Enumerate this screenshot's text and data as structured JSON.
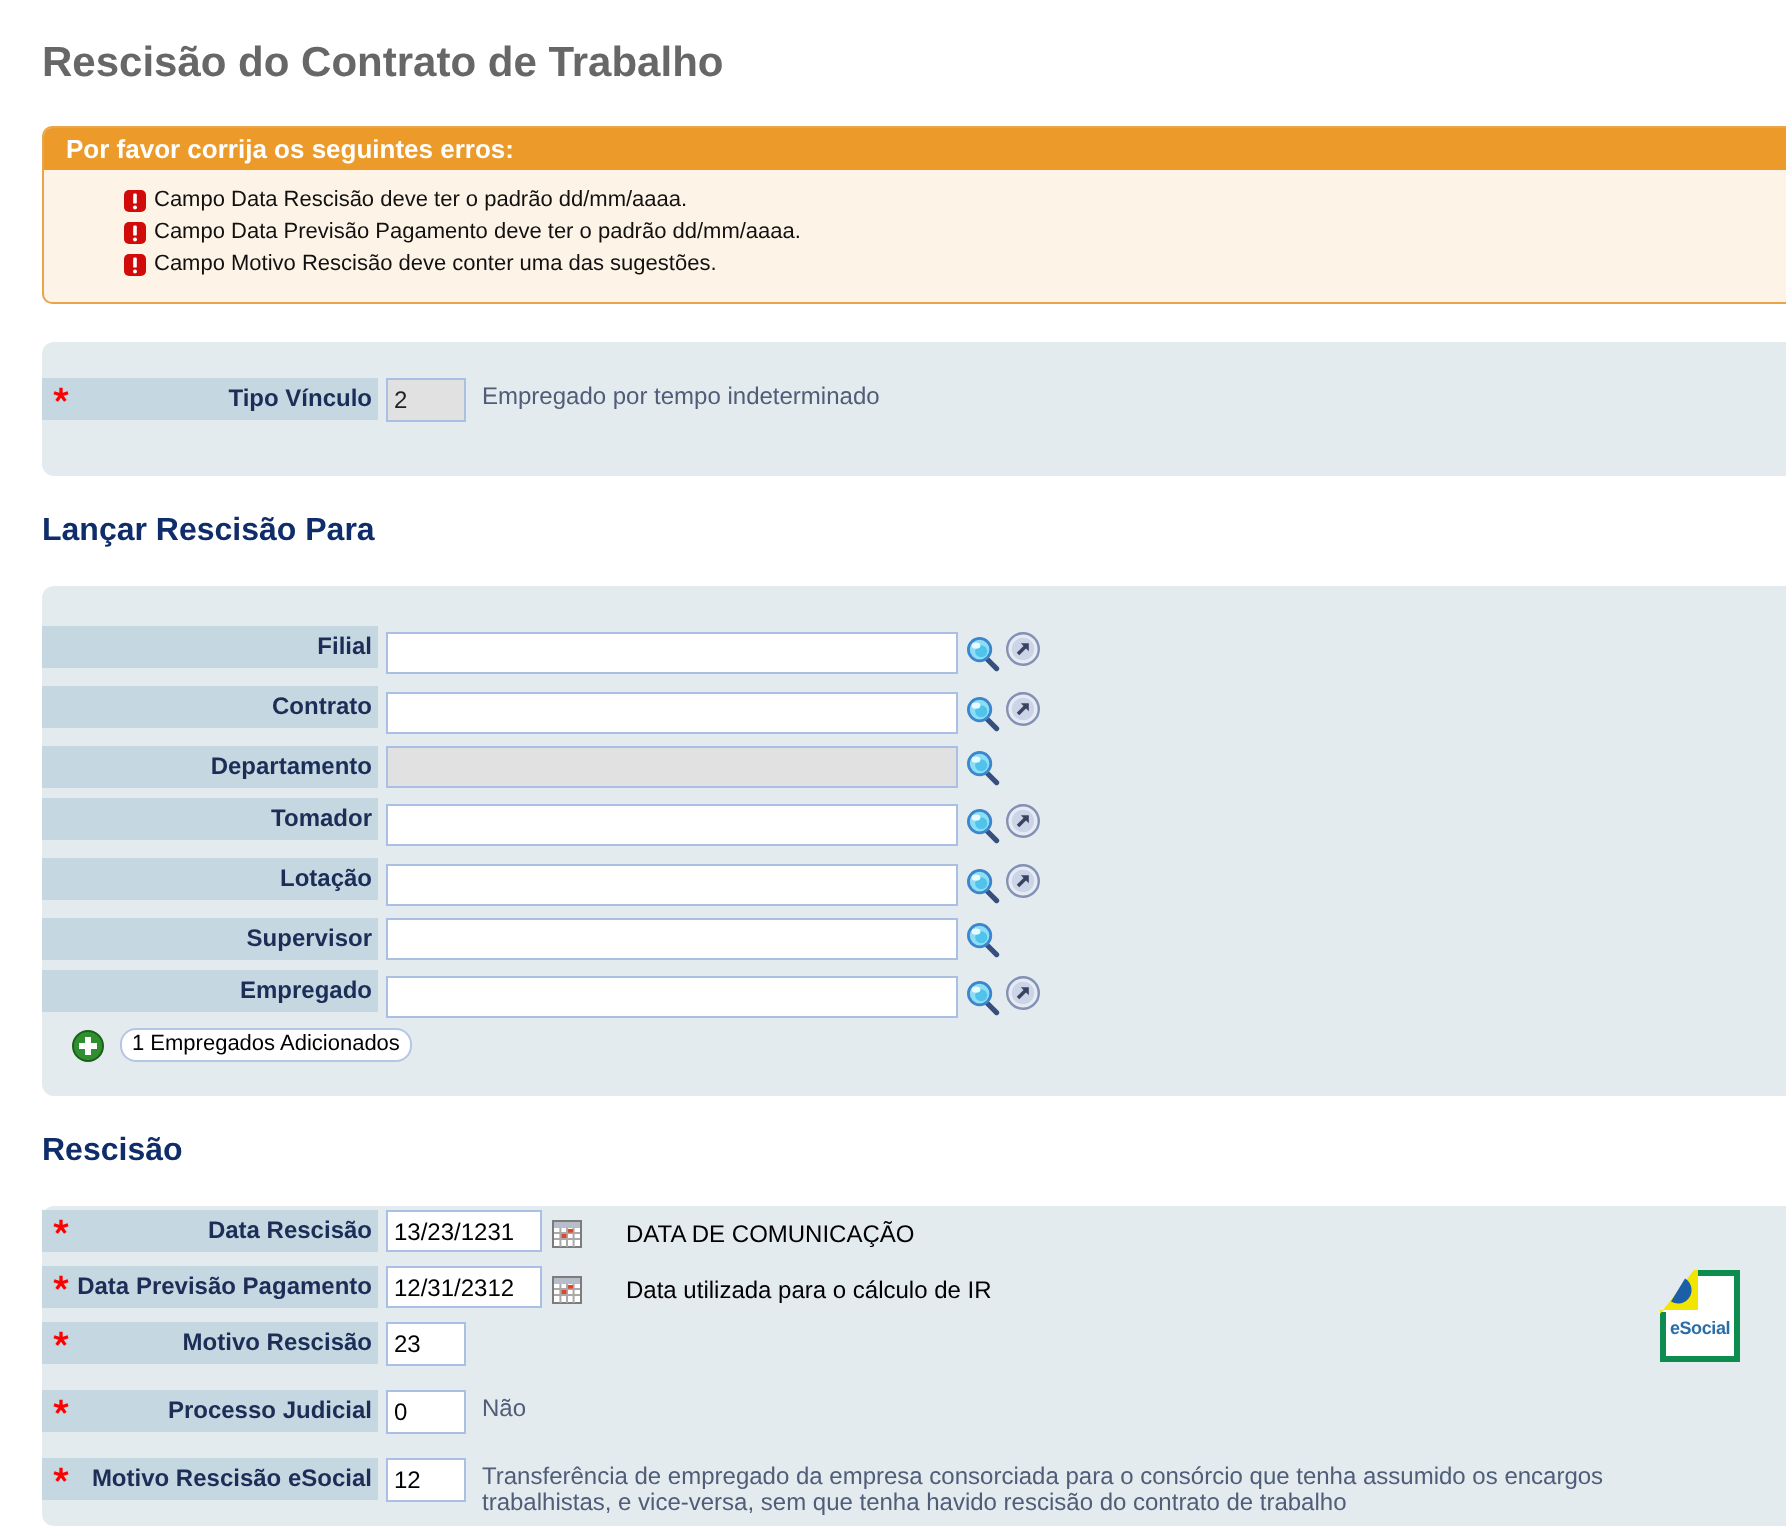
{
  "page": {
    "title": "Rescisão do Contrato de Trabalho"
  },
  "errors": {
    "title": "Por favor corrija os seguintes erros:",
    "items": [
      "Campo Data Rescisão deve ter o padrão dd/mm/aaaa.",
      "Campo Data Previsão Pagamento deve ter o padrão dd/mm/aaaa.",
      "Campo Motivo Rescisão deve conter uma das sugestões."
    ]
  },
  "vinculo": {
    "fields": [
      {
        "label": "Tipo Vínculo",
        "kind": "code",
        "required": true,
        "disabled": true,
        "value": "2",
        "description": "Empregado por tempo indeterminado"
      }
    ]
  },
  "lancar": {
    "title": "Lançar Rescisão Para",
    "fields": [
      {
        "label": "Filial",
        "disabled": false,
        "lookup": true,
        "shortcut": true
      },
      {
        "label": "Contrato",
        "disabled": false,
        "lookup": true,
        "shortcut": true
      },
      {
        "label": "Departamento",
        "disabled": true,
        "lookup": true,
        "shortcut": false
      },
      {
        "label": "Tomador",
        "disabled": false,
        "lookup": true,
        "shortcut": true
      },
      {
        "label": "Lotação",
        "disabled": false,
        "lookup": true,
        "shortcut": true
      },
      {
        "label": "Supervisor",
        "disabled": false,
        "lookup": true,
        "shortcut": false
      },
      {
        "label": "Empregado",
        "disabled": false,
        "lookup": true,
        "shortcut": true
      }
    ],
    "added_button": "1 Empregados Adicionados"
  },
  "rescisao": {
    "title": "Rescisão",
    "fields": [
      {
        "label": "Data Rescisão",
        "kind": "date",
        "required": true,
        "disabled": false,
        "value": "13/23/1231",
        "description": "DATA DE COMUNICAÇÃO"
      },
      {
        "label": "Data Previsão Pagamento",
        "kind": "date",
        "required": true,
        "disabled": false,
        "value": "12/31/2312",
        "description": "Data utilizada para o cálculo de IR"
      },
      {
        "label": "Motivo Rescisão",
        "kind": "code",
        "required": true,
        "disabled": false,
        "value": "23"
      },
      {
        "label": "Processo Judicial",
        "kind": "code",
        "required": true,
        "disabled": false,
        "value": "0",
        "description": "Não"
      },
      {
        "label": "Motivo Rescisão eSocial",
        "kind": "code",
        "required": true,
        "disabled": false,
        "value": "12",
        "description": "Transferência de empregado da empresa consorciada para o consórcio que tenha assumido os encargos trabalhistas, e vice-versa, sem que tenha havido rescisão do contrato de trabalho"
      }
    ],
    "logo": "eSocial"
  }
}
